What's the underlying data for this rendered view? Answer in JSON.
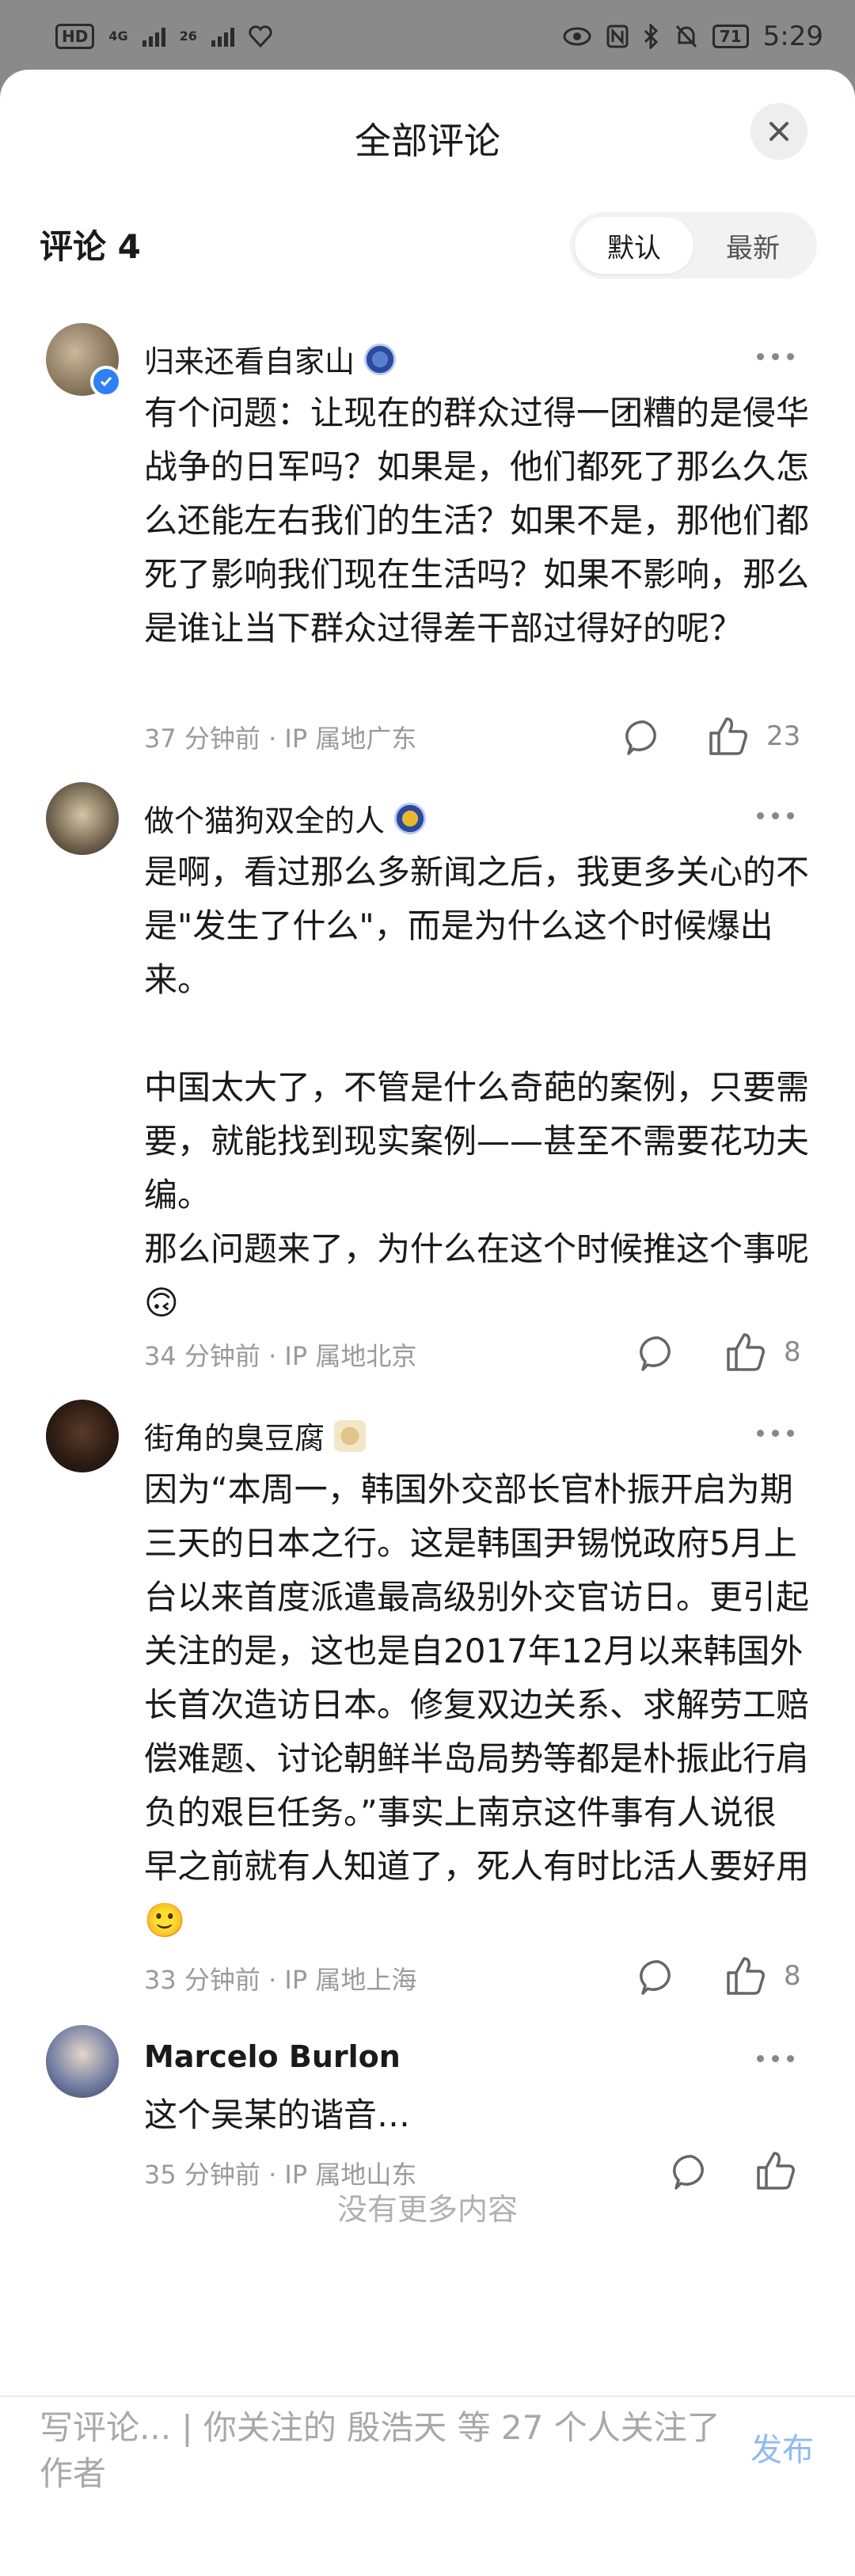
{
  "status_bar": {
    "hd": "HD",
    "net1": "4G",
    "net2": "26",
    "battery": "71",
    "time": "5:29"
  },
  "sheet": {
    "title": "全部评论",
    "comments_label": "评论 4",
    "sort": {
      "default": "默认",
      "latest": "最新",
      "selected": "默认"
    }
  },
  "comments": [
    {
      "username": "归来还看自家山",
      "text": "有个问题：让现在的群众过得一团糟的是侵华战争的日军吗？如果是，他们都死了那么久怎么还能左右我们的生活？如果不是，那他们都死了影响我们现在生活吗？如果不影响，那么是谁让当下群众过得差干部过得好的呢？",
      "meta": "37 分钟前 · IP 属地广东",
      "likes": "23",
      "verified": true
    },
    {
      "username": "做个猫狗双全的人",
      "text": "是啊，看过那么多新闻之后，我更多关心的不是\"发生了什么\"，而是为什么这个时候爆出来。\n\n中国太大了，不管是什么奇葩的案例，只要需要，就能找到现实案例——甚至不需要花功夫编。\n那么问题来了，为什么在这个时候推这个事呢🙃",
      "meta": "34 分钟前 · IP 属地北京",
      "likes": "8"
    },
    {
      "username": "街角的臭豆腐",
      "text": "因为“本周一，韩国外交部长官朴振开启为期三天的日本之行。这是韩国尹锡悦政府5月上台以来首度派遣最高级别外交官访日。更引起关注的是，这也是自2017年12月以来韩国外长首次造访日本。修复双边关系、求解劳工赔偿难题、讨论朝鲜半岛局势等都是朴振此行肩负的艰巨任务。”事实上南京这件事有人说很早之前就有人知道了，死人有时比活人要好用🙂",
      "meta": "33 分钟前 · IP 属地上海",
      "likes": "8"
    },
    {
      "username": "Marcelo Burlon",
      "text": "这个吴某的谐音…",
      "meta": "35 分钟前 · IP 属地山东",
      "likes": ""
    }
  ],
  "footer": {
    "no_more": "没有更多内容",
    "input_placeholder": "写评论... | 你关注的 殷浩天 等 27 个人关注了作者",
    "publish": "发布"
  },
  "colors": {
    "verified_blue": "#2f7ff5",
    "publish_blue": "#8fbaf5",
    "meta_gray": "#9a9a9a"
  }
}
